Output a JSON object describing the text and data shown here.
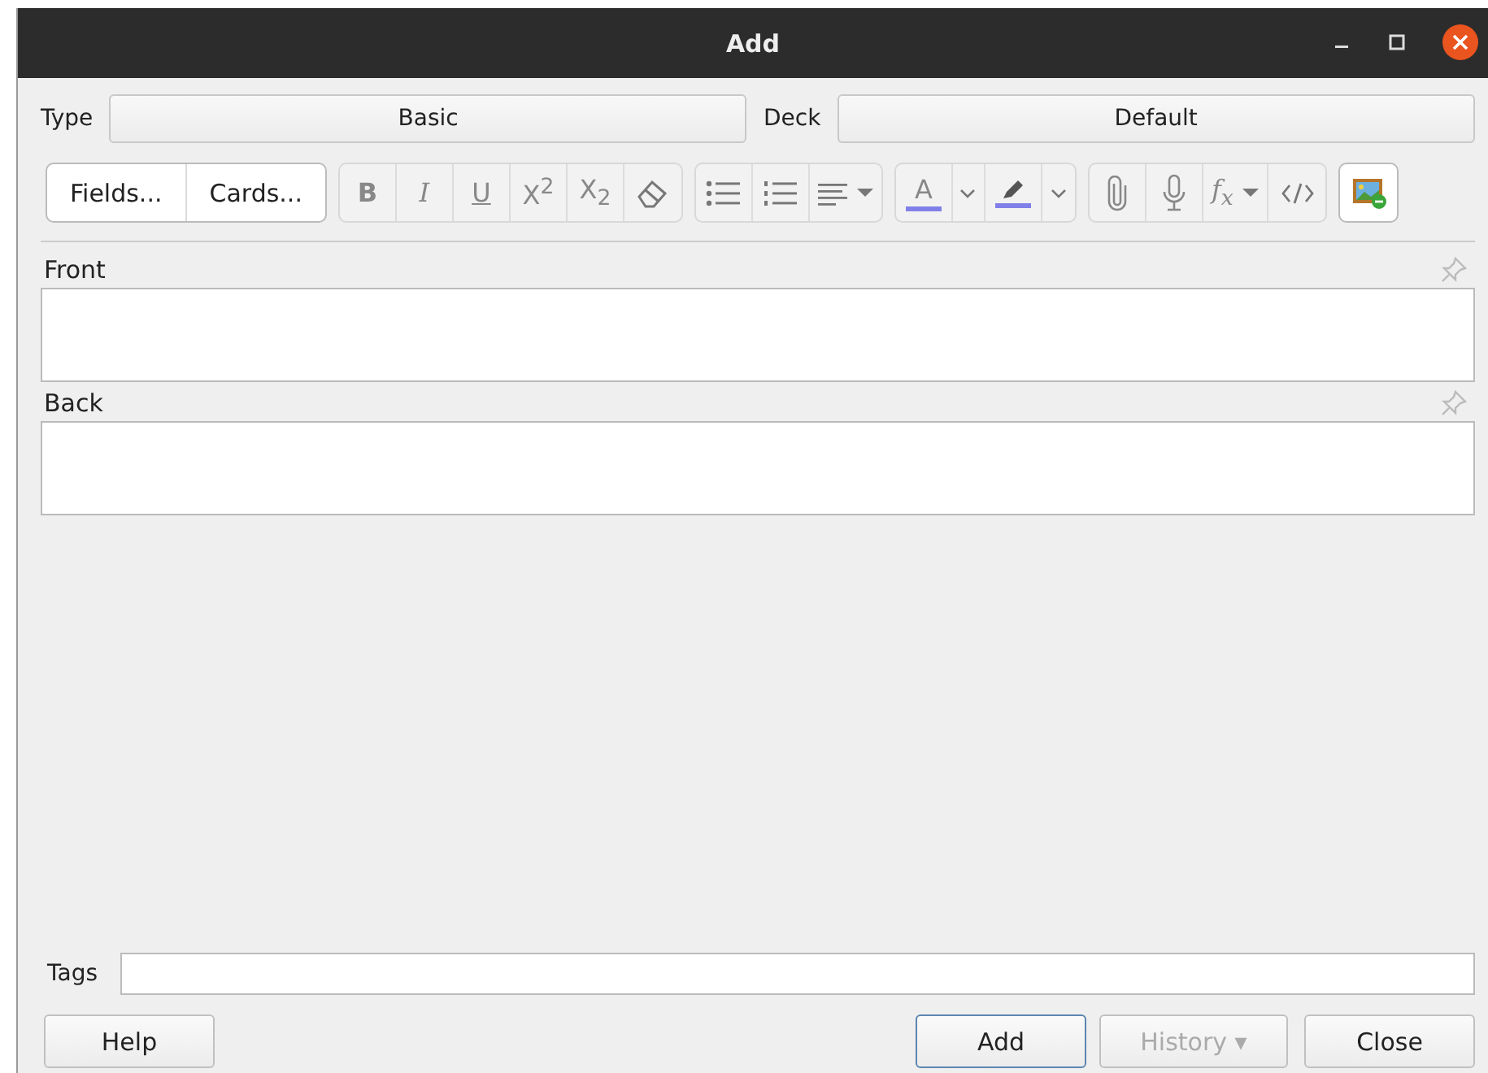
{
  "window": {
    "title": "Add"
  },
  "type": {
    "label": "Type",
    "value": "Basic"
  },
  "deck": {
    "label": "Deck",
    "value": "Default"
  },
  "toolbar": [
    {
      "buttons": [
        {
          "kind": "text",
          "label": "Fields..."
        },
        {
          "kind": "text",
          "label": "Cards..."
        }
      ]
    },
    {
      "buttons": [
        {
          "kind": "bold",
          "label": "B"
        },
        {
          "kind": "italic",
          "label": "I"
        },
        {
          "kind": "underline",
          "label": "U"
        },
        {
          "kind": "script",
          "label": "X$^{2}$"
        },
        {
          "kind": "script",
          "label": "X$_{2}$"
        },
        {
          "kind": "eraser"
        }
      ]
    },
    {
      "buttons": [
        {
          "kind": "bullets"
        },
        {
          "kind": "numbers"
        },
        {
          "kind": "align"
        }
      ]
    },
    {
      "buttons": [
        {
          "kind": "textcolor",
          "label": "A",
          "color": "#8080e8"
        },
        {
          "kind": "chevron"
        },
        {
          "kind": "highlight",
          "color": "#8080e8"
        },
        {
          "kind": "chevron"
        }
      ]
    },
    {
      "buttons": [
        {
          "kind": "clip"
        },
        {
          "kind": "mic"
        },
        {
          "kind": "formula",
          "label": "f$_{x}$"
        },
        {
          "kind": "html"
        }
      ]
    },
    {
      "buttons": [
        {
          "kind": "image"
        }
      ]
    }
  ],
  "fields": [
    {
      "name": "Front"
    },
    {
      "name": "Back"
    }
  ],
  "tags": {
    "label": "Tags"
  },
  "buttons_left": [
    {
      "label": "Help",
      "default": false,
      "disabled": false
    }
  ],
  "buttons_right": [
    {
      "label": "Add",
      "default": true,
      "disabled": false
    },
    {
      "label": "History ▾",
      "default": false,
      "disabled": true
    },
    {
      "label": "Close",
      "default": false,
      "disabled": false
    }
  ]
}
